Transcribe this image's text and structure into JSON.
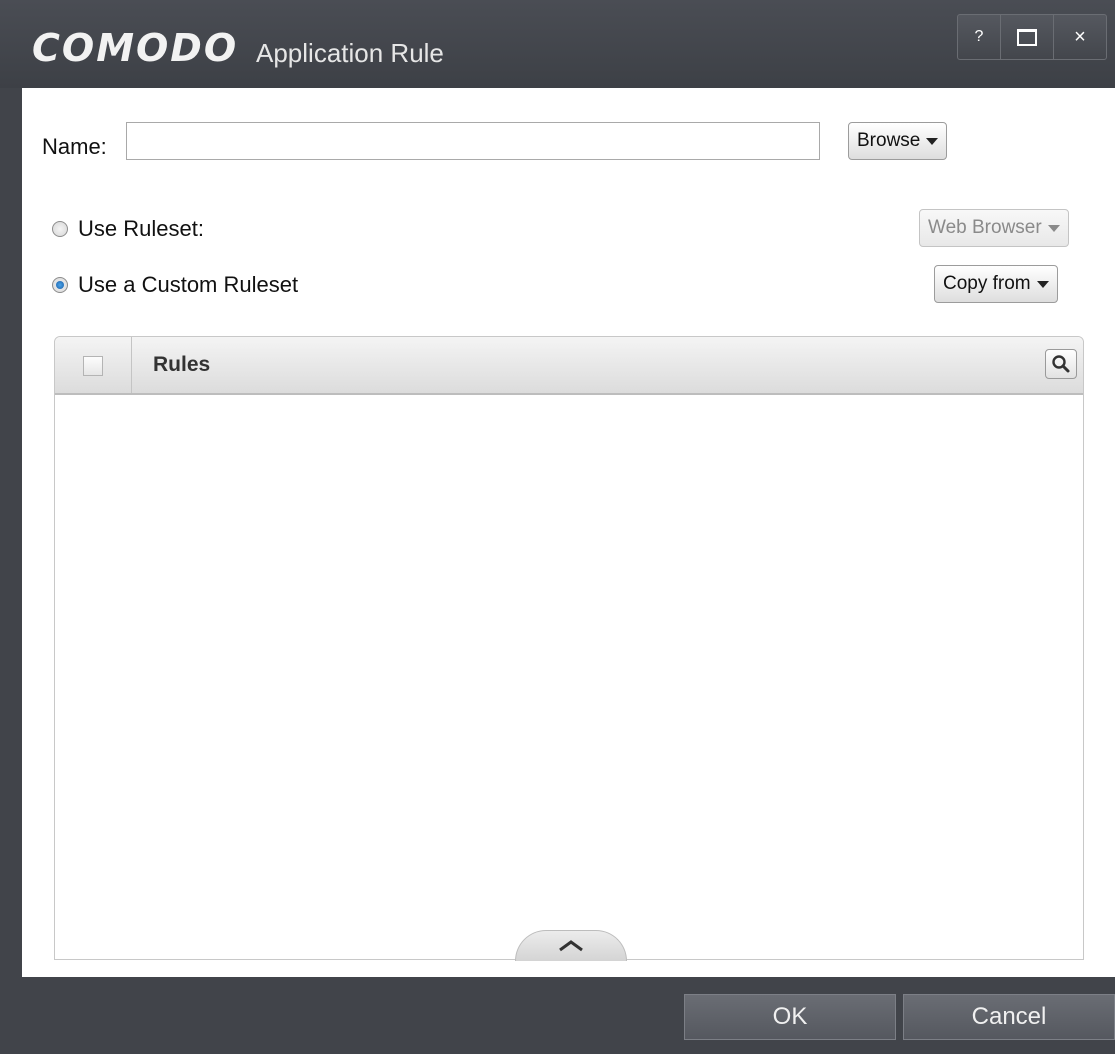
{
  "titlebar": {
    "brand": "COMODO",
    "title": "Application Rule",
    "help_label": "?",
    "close_label": "×"
  },
  "form": {
    "name_label": "Name:",
    "name_value": "",
    "browse_label": "Browse"
  },
  "ruleset": {
    "use_ruleset_label": "Use Ruleset:",
    "use_ruleset_checked": false,
    "ruleset_select_value": "Web Browser",
    "custom_ruleset_label": "Use a Custom Ruleset",
    "custom_ruleset_checked": true,
    "copy_from_label": "Copy from"
  },
  "table": {
    "column_rules": "Rules",
    "rows": []
  },
  "footer": {
    "ok_label": "OK",
    "cancel_label": "Cancel"
  },
  "colors": {
    "titlebar": "#41444a",
    "panel": "#ffffff",
    "radio_accent": "#1c5fa8"
  }
}
